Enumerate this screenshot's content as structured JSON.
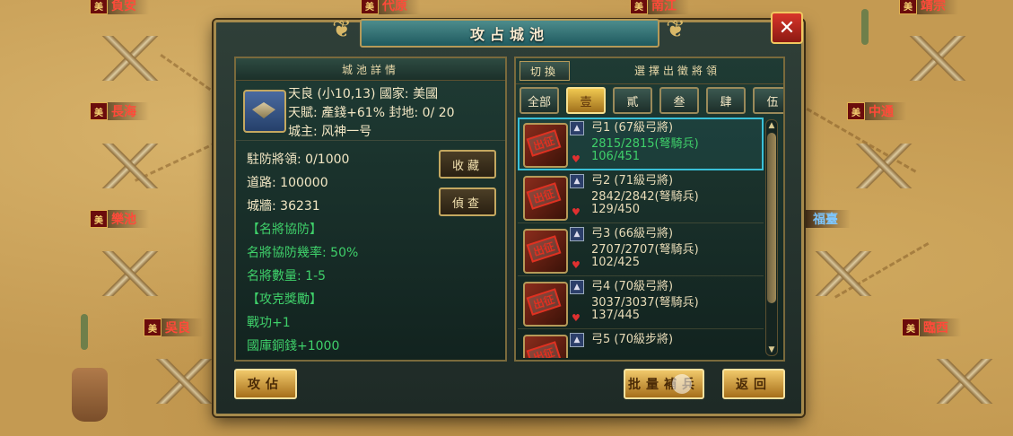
{
  "map": {
    "cities": [
      {
        "name": "負安",
        "side": "red"
      },
      {
        "name": "代原",
        "side": "red"
      },
      {
        "name": "南江",
        "side": "red"
      },
      {
        "name": "靖宗",
        "side": "red"
      },
      {
        "name": "長海",
        "side": "red"
      },
      {
        "name": "中通",
        "side": "red"
      },
      {
        "name": "樂池",
        "side": "red"
      },
      {
        "name": "福臺",
        "side": "blue"
      },
      {
        "name": "吳良",
        "side": "red"
      },
      {
        "name": "臨西",
        "side": "red"
      }
    ],
    "flag_char": "美"
  },
  "dialog": {
    "title": "攻占城池",
    "close_icon": "close-icon",
    "left": {
      "header": "城池詳情",
      "city_line1": "天良 (小10,13)  國家: 美國",
      "city_line2": "天賦: 產錢+61% 封地: 0/ 20",
      "city_line3": "城主: 风神一号",
      "stats": [
        {
          "text": "駐防將領: 0/1000",
          "color": "normal"
        },
        {
          "text": "道路: 100000",
          "color": "normal"
        },
        {
          "text": "城牆: 36231",
          "color": "normal"
        },
        {
          "text": "【名將協防】",
          "color": "green"
        },
        {
          "text": "名將協防幾率:  50%",
          "color": "green"
        },
        {
          "text": "名將數量:  1-5",
          "color": "green"
        },
        {
          "text": "【攻克獎勵】",
          "color": "green"
        },
        {
          "text": "戰功+1",
          "color": "green"
        },
        {
          "text": "國庫銅錢+1000",
          "color": "green"
        }
      ],
      "collect_label": "收藏",
      "scout_label": "偵查"
    },
    "right": {
      "switch_label": "切換",
      "header": "選擇出徵將領",
      "tabs": [
        "全部",
        "壹",
        "貳",
        "叁",
        "肆",
        "伍"
      ],
      "active_tab": "壹",
      "stamp_text": "出征",
      "generals": [
        {
          "name": "弓1 (67級弓將)",
          "troops": "2815/2815(弩騎兵)",
          "energy": "106/451",
          "selected": true
        },
        {
          "name": "弓2 (71級弓將)",
          "troops": "2842/2842(弩騎兵)",
          "energy": "129/450",
          "selected": false
        },
        {
          "name": "弓3 (66級弓將)",
          "troops": "2707/2707(弩騎兵)",
          "energy": "102/425",
          "selected": false
        },
        {
          "name": "弓4 (70級弓將)",
          "troops": "3037/3037(弩騎兵)",
          "energy": "137/445",
          "selected": false
        },
        {
          "name": "弓5 (70級步將)",
          "troops": "",
          "energy": "",
          "selected": false
        }
      ]
    },
    "buttons": {
      "attack": "攻佔",
      "batch": "批量補兵",
      "back": "返回"
    }
  }
}
